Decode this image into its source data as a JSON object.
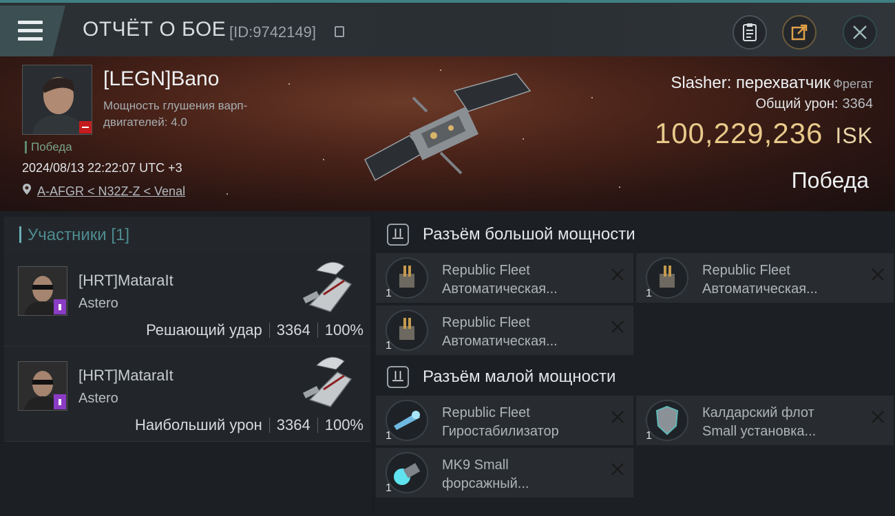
{
  "header": {
    "title": "ОТЧЁТ О БОЕ",
    "report_id": "[ID:9742149]",
    "menu_icon": "hamburger-icon",
    "buttons": [
      "clipboard-icon",
      "share-icon",
      "close-icon"
    ]
  },
  "victim": {
    "name": "[LEGN]Bano",
    "warp_label": "Мощность глушения варп-двигателей: 4.0",
    "result_tag": "Победа",
    "datetime": "2024/08/13 22:22:07 UTC +3",
    "location": "A-AFGR < N32Z-Z < Venal",
    "ship_name": "Slasher: перехватчик",
    "ship_class": "Фрегат",
    "damage_label": "Общий урон:",
    "damage_value": "3364",
    "isk_value": "100,229,236",
    "isk_unit": "ISK",
    "result_big": "Победа"
  },
  "participants": {
    "title": "Участники [1]",
    "items": [
      {
        "name": "[HRT]MataraIt",
        "ship": "Astero",
        "role": "Решающий удар",
        "damage": "3364",
        "percent": "100%"
      },
      {
        "name": "[HRT]MataraIt",
        "ship": "Astero",
        "role": "Наибольший урон",
        "damage": "3364",
        "percent": "100%"
      }
    ]
  },
  "slots": {
    "high": {
      "title": "Разъём большой мощности",
      "modules": [
        {
          "qty": "1",
          "line1": "Republic Fleet",
          "line2": "Автоматическая..."
        },
        {
          "qty": "1",
          "line1": "Republic Fleet",
          "line2": "Автоматическая..."
        },
        {
          "qty": "1",
          "line1": "Republic Fleet",
          "line2": "Автоматическая..."
        }
      ]
    },
    "low": {
      "title": "Разъём малой мощности",
      "modules": [
        {
          "qty": "1",
          "line1": "Republic Fleet",
          "line2": "Гиростабилизатор"
        },
        {
          "qty": "1",
          "line1": "Калдарский флот",
          "line2": "Small установка..."
        },
        {
          "qty": "1",
          "line1": "MK9 Small",
          "line2": "форсажный..."
        }
      ]
    }
  },
  "colors": {
    "accent": "#3f7f83",
    "isk": "#e8c98a",
    "badge_red": "#c41c1c",
    "badge_purple": "#8a3cc4"
  }
}
